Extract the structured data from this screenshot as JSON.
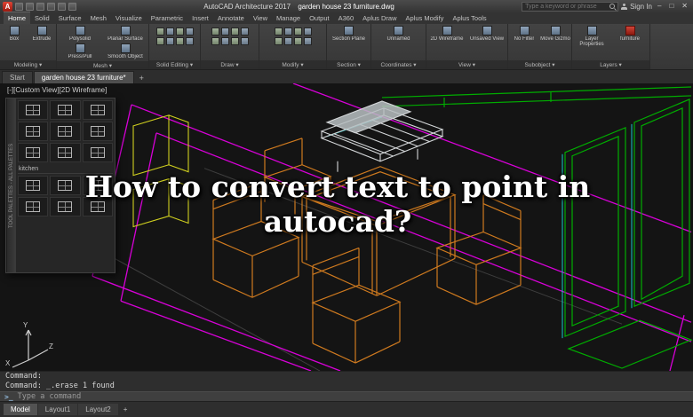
{
  "titlebar": {
    "app_name": "AutoCAD Architecture 2017",
    "doc_name": "garden house 23 furniture.dwg",
    "search_placeholder": "Type a keyword or phrase",
    "sign_in_label": "Sign In",
    "minimize_label": "–",
    "maximize_label": "□",
    "close_label": "✕"
  },
  "ribbon": {
    "tabs": [
      "Home",
      "Solid",
      "Surface",
      "Mesh",
      "Visualize",
      "Parametric",
      "Insert",
      "Annotate",
      "View",
      "Manage",
      "Output",
      "A360",
      "Aplus Draw",
      "Aplus Modify",
      "Aplus Tools"
    ],
    "active_tab": "Home",
    "panels": [
      {
        "label": "Modeling",
        "items": [
          "Box",
          "Extrude"
        ]
      },
      {
        "label": "Mesh",
        "items": [
          "Polysolid",
          "Planar Surface",
          "Press/Pull",
          "Smooth Object"
        ]
      },
      {
        "label": "Solid Editing",
        "items": []
      },
      {
        "label": "Draw",
        "items": []
      },
      {
        "label": "Modify",
        "items": []
      },
      {
        "label": "Section",
        "items": [
          "Section Plane"
        ]
      },
      {
        "label": "Coordinates",
        "items": [
          "Unnamed"
        ]
      },
      {
        "label": "View",
        "items": [
          "2D Wireframe",
          "Unsaved View"
        ]
      },
      {
        "label": "Subobject",
        "items": [
          "No Filter",
          "Move Gizmo"
        ]
      },
      {
        "label": "Layers",
        "items": [
          "Layer Properties",
          "furniture"
        ]
      }
    ]
  },
  "file_tabs": {
    "tabs": [
      "Start",
      "garden house 23 furniture*"
    ],
    "active": "garden house 23 furniture*",
    "new_tab_label": "+"
  },
  "palette": {
    "title": "TOOL PALETTES - ALL PALETTES",
    "group_label": "kitchen",
    "block_count": 15
  },
  "viewport": {
    "label": "[-][Custom View][2D Wireframe]",
    "ucs": {
      "x": "X",
      "y": "Y",
      "z": "Z"
    }
  },
  "overlay_title": "How to convert text to point in autocad?",
  "command_line": {
    "history": [
      "Command:",
      "Command: _.erase 1 found"
    ],
    "prompt_icon": ">_",
    "prompt_placeholder": "Type a command"
  },
  "status_bar": {
    "tabs": [
      "Model",
      "Layout1",
      "Layout2"
    ],
    "active_tab": "Model",
    "new_layout_label": "+"
  },
  "colors": {
    "boundary_magenta": "#d800d8",
    "furniture_orange": "#cf7a1f",
    "panel_green": "#00ad00",
    "accent_cyan": "#19c8c8",
    "object_white": "#d4d7d9",
    "block_yellow": "#cfcf1f"
  }
}
